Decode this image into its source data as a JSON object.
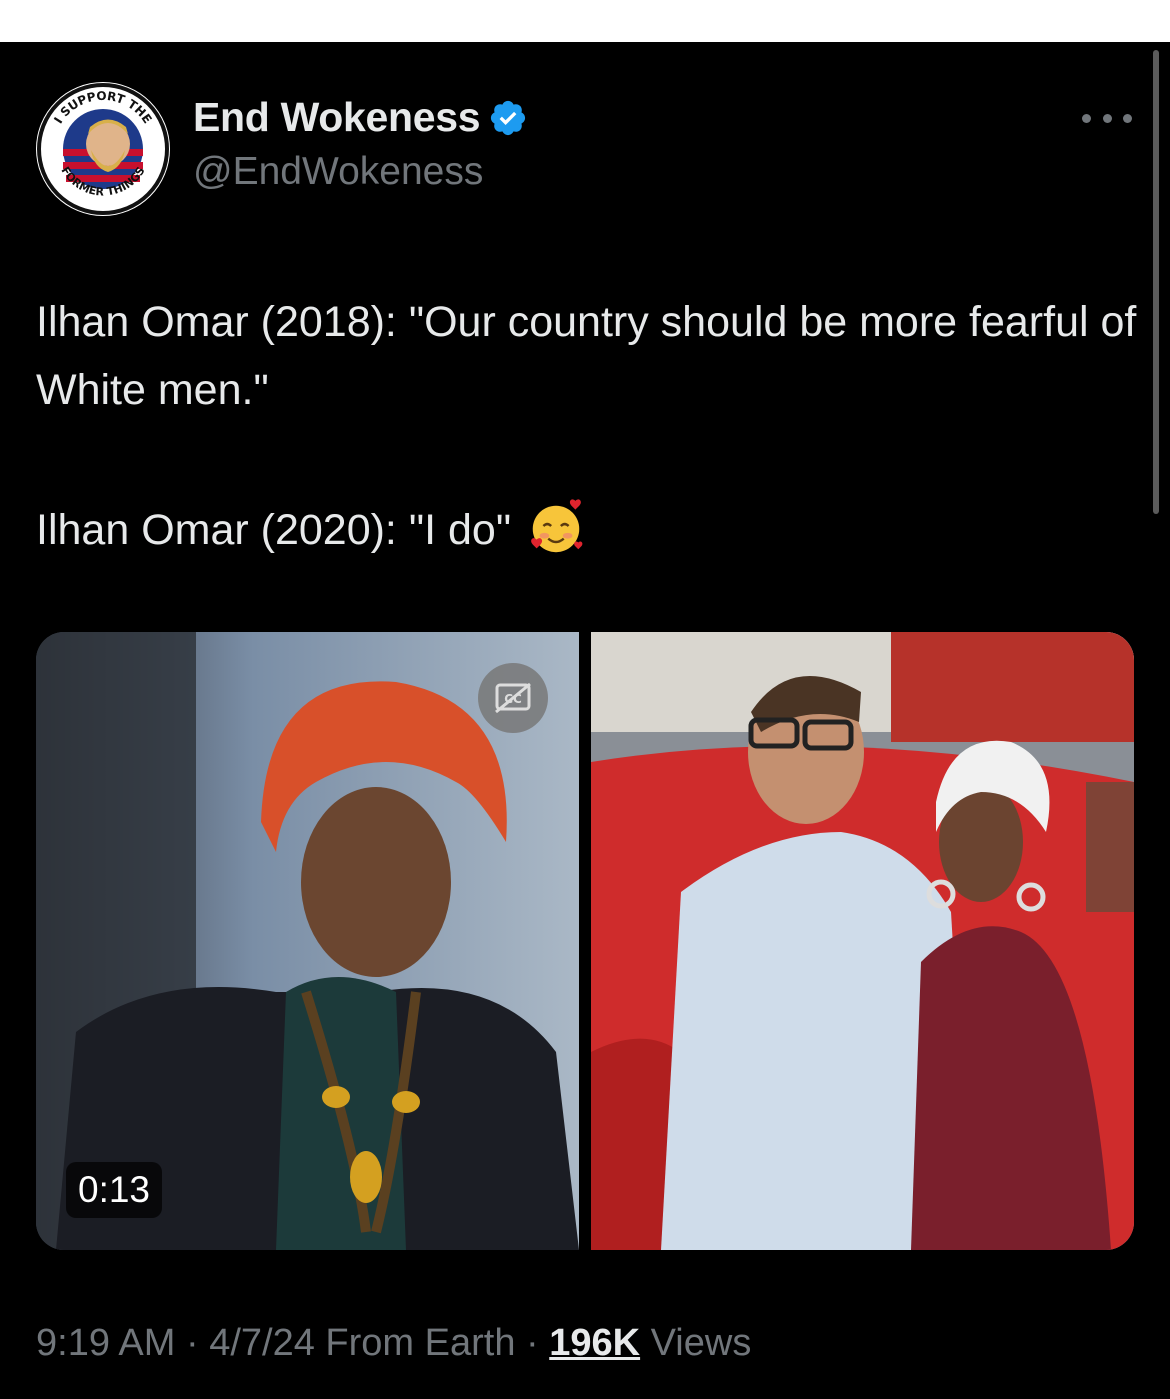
{
  "author": {
    "name": "End Wokeness",
    "handle": "@EndWokeness",
    "avatar_icon": "support-former-things-badge-icon",
    "avatar_text": "I SUPPORT THE FORMER THINGS",
    "verified_icon": "verified-badge-icon",
    "verified_color": "#1d9bf0"
  },
  "more_icon": "more-dots-icon",
  "tweet": {
    "line1": "Ilhan Omar (2018): \"Our country should be more fearful of White men.\"",
    "line2": "Ilhan Omar (2020): \"I do\"",
    "emoji_icon": "smiling-face-with-hearts-icon"
  },
  "media": {
    "video_duration": "0:13",
    "cc_icon": "closed-captions-off-icon"
  },
  "meta": {
    "time": "9:19 AM",
    "separator": " · ",
    "date": "4/7/24",
    "source": " From Earth",
    "views_count": "196K",
    "views_label": " Views"
  },
  "colors": {
    "background": "#000000",
    "primary_text": "#e7e9ea",
    "secondary_text": "#71767b"
  }
}
